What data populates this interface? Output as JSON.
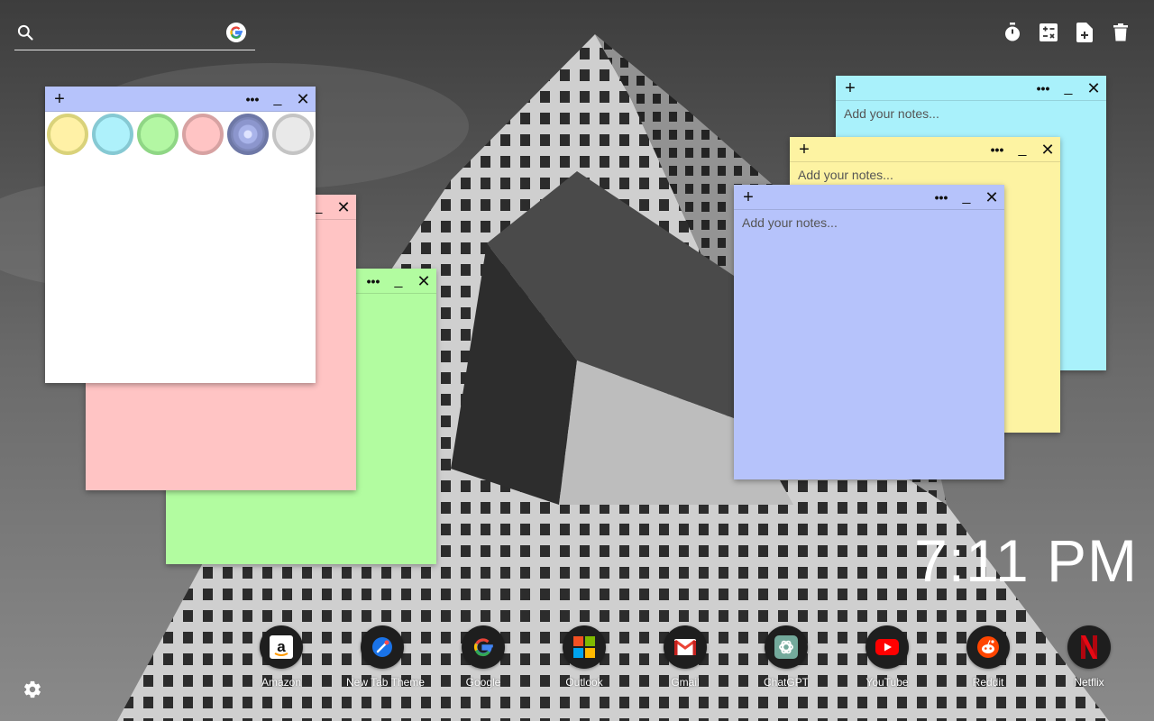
{
  "search": {
    "placeholder": ""
  },
  "toolbar": {
    "items": [
      {
        "icon": "timer-icon"
      },
      {
        "icon": "calculator-icon"
      },
      {
        "icon": "new-note-icon"
      },
      {
        "icon": "trash-icon"
      }
    ]
  },
  "notes": [
    {
      "id": "white",
      "color": "#ffffff",
      "placeholder": ""
    },
    {
      "id": "pink",
      "color": "#ffc4c4",
      "placeholder": ""
    },
    {
      "id": "green",
      "color": "#b2fca0",
      "placeholder": ""
    },
    {
      "id": "cyan",
      "color": "#a9f1fb",
      "placeholder": "Add your notes..."
    },
    {
      "id": "yellow",
      "color": "#fdf3a2",
      "placeholder": "Add your notes..."
    },
    {
      "id": "blue",
      "color": "#b6c3fb",
      "placeholder": "Add your notes..."
    }
  ],
  "note_controls": {
    "add": "+",
    "more": "•••",
    "minimize": "_",
    "close": "✕"
  },
  "color_picker": {
    "colors": [
      "#fff1a6",
      "#aef1fb",
      "#b3f7a3",
      "#ffc4c4",
      "#7c86b7",
      "#e9e9e9"
    ],
    "selected": "#7c86b7"
  },
  "clock": {
    "time": "7:11 PM"
  },
  "dock": [
    {
      "label": "Amazon",
      "icon": "amazon-icon"
    },
    {
      "label": "New Tab Theme",
      "icon": "new-tab-theme-icon"
    },
    {
      "label": "Google",
      "icon": "google-icon"
    },
    {
      "label": "Outlook",
      "icon": "microsoft-icon"
    },
    {
      "label": "Gmail",
      "icon": "gmail-icon"
    },
    {
      "label": "ChatGPT",
      "icon": "chatgpt-icon"
    },
    {
      "label": "YouTube",
      "icon": "youtube-icon"
    },
    {
      "label": "Reddit",
      "icon": "reddit-icon"
    },
    {
      "label": "Netflix",
      "icon": "netflix-icon"
    }
  ],
  "settings": {
    "icon": "gear-icon"
  }
}
